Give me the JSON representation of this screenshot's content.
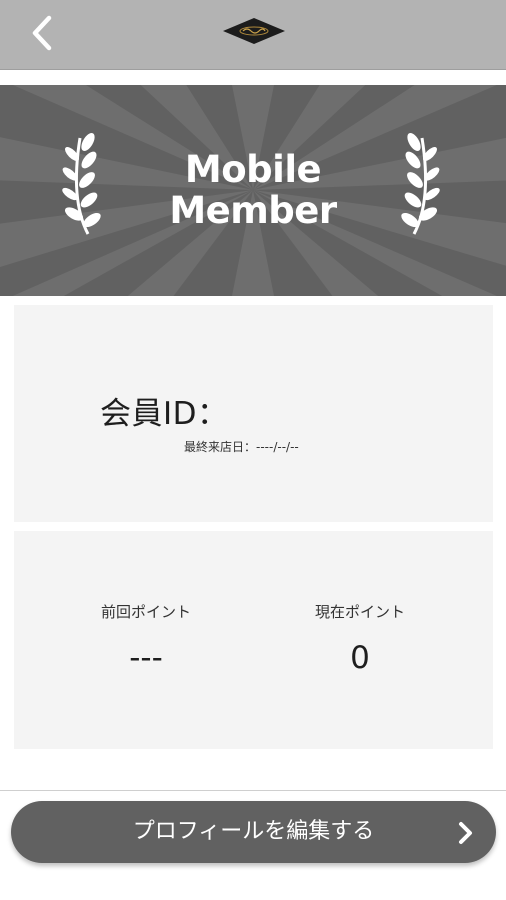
{
  "header": {
    "back_icon": "chevron-left-icon",
    "logo_icon": "brand-logo-icon",
    "bg_color": "#b3b3b3"
  },
  "banner": {
    "title_line1": "Mobile",
    "title_line2": "Member",
    "bg_color": "#616161",
    "left_icon": "laurel-icon",
    "right_icon": "laurel-icon"
  },
  "member": {
    "id_label": "会員ID：",
    "last_visit": "最終来店日：----/--/--"
  },
  "points": {
    "previous_label": "前回ポイント",
    "previous_value": "---",
    "current_label": "現在ポイント",
    "current_value": "0"
  },
  "actions": {
    "edit_profile_label": "プロフィールを編集する",
    "edit_profile_icon": "chevron-right-icon",
    "button_color": "#616161"
  }
}
